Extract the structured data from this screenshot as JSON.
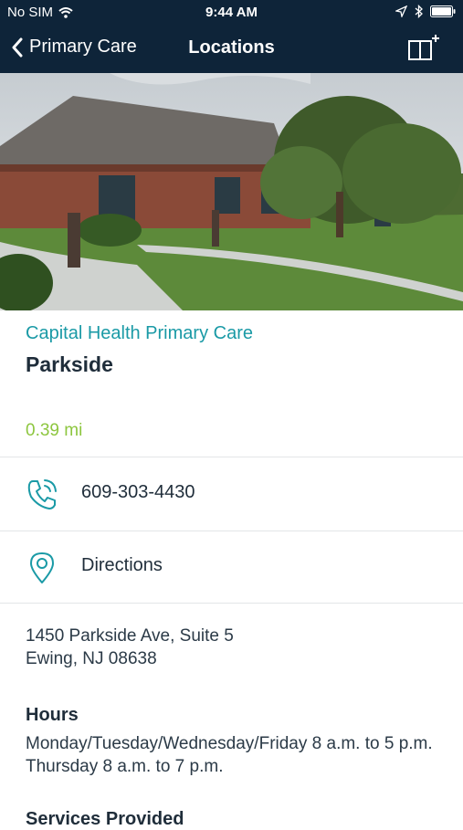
{
  "status_bar": {
    "carrier": "No SIM",
    "time": "9:44 AM"
  },
  "nav": {
    "back_label": "Primary Care",
    "title": "Locations"
  },
  "location": {
    "organization": "Capital Health Primary Care",
    "name": "Parkside",
    "distance": "0.39 mi",
    "phone": "609-303-4430",
    "directions_label": "Directions",
    "address_line1": "1450 Parkside Ave, Suite 5",
    "address_line2": "Ewing, NJ 08638",
    "hours_heading": "Hours",
    "hours_text": "Monday/Tuesday/Wednesday/Friday 8 a.m. to 5 p.m. Thursday 8 a.m. to 7 p.m.",
    "services_heading": "Services Provided"
  },
  "colors": {
    "nav_bg": "#0e2439",
    "accent_teal": "#1a9aa6",
    "distance_green": "#8dc63f"
  }
}
